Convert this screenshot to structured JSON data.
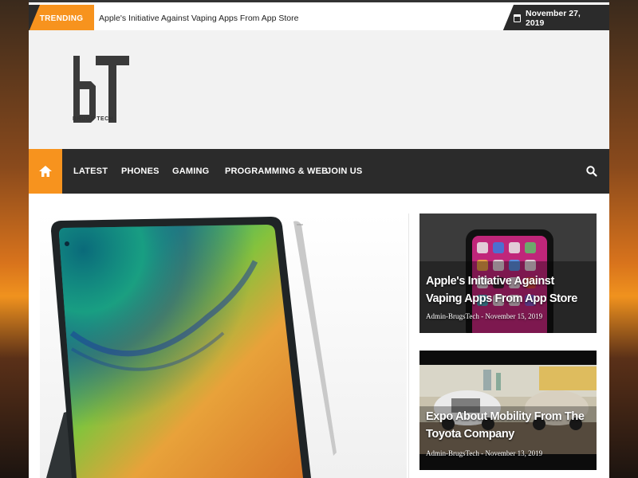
{
  "topbar": {
    "trending_label": "TRENDING",
    "trending_headline": "Apple's Initiative Against Vaping Apps From App Store",
    "date": "November 27, 2019"
  },
  "header": {
    "logo_text": "BT",
    "logo_subtitle": "BRUGS TECH"
  },
  "nav": {
    "home_icon": "home-icon",
    "items": [
      "LATEST",
      "PHONES",
      "GAMING",
      "PROGRAMMING & WEB",
      "JOIN US"
    ],
    "search_icon": "search-icon"
  },
  "articles": [
    {
      "title": "Apple's Initiative Against Vaping Apps From App Store",
      "author": "Admin-BrugsTech",
      "date": "November 15, 2019"
    },
    {
      "title": "Expo About Mobility From The Toyota Company",
      "author": "Admin-BrugsTech",
      "date": "November 13, 2019"
    }
  ],
  "colors": {
    "accent": "#f7931e",
    "dark": "#2b2b2b",
    "header_bg": "#f2f2f2"
  }
}
